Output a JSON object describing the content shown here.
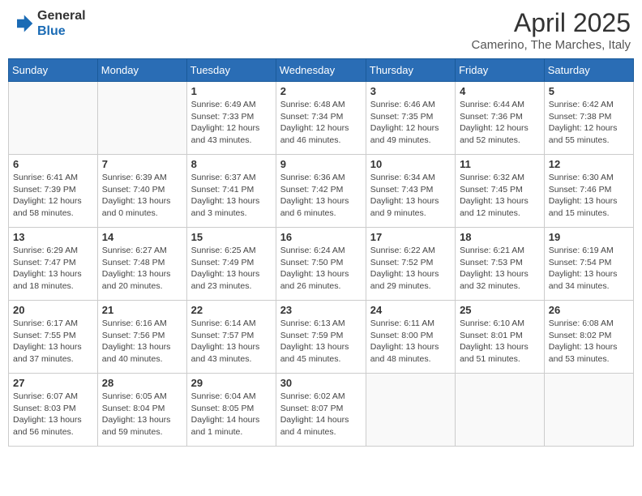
{
  "header": {
    "logo_general": "General",
    "logo_blue": "Blue",
    "main_title": "April 2025",
    "subtitle": "Camerino, The Marches, Italy"
  },
  "weekdays": [
    "Sunday",
    "Monday",
    "Tuesday",
    "Wednesday",
    "Thursday",
    "Friday",
    "Saturday"
  ],
  "weeks": [
    [
      {
        "day": "",
        "info": ""
      },
      {
        "day": "",
        "info": ""
      },
      {
        "day": "1",
        "info": "Sunrise: 6:49 AM\nSunset: 7:33 PM\nDaylight: 12 hours and 43 minutes."
      },
      {
        "day": "2",
        "info": "Sunrise: 6:48 AM\nSunset: 7:34 PM\nDaylight: 12 hours and 46 minutes."
      },
      {
        "day": "3",
        "info": "Sunrise: 6:46 AM\nSunset: 7:35 PM\nDaylight: 12 hours and 49 minutes."
      },
      {
        "day": "4",
        "info": "Sunrise: 6:44 AM\nSunset: 7:36 PM\nDaylight: 12 hours and 52 minutes."
      },
      {
        "day": "5",
        "info": "Sunrise: 6:42 AM\nSunset: 7:38 PM\nDaylight: 12 hours and 55 minutes."
      }
    ],
    [
      {
        "day": "6",
        "info": "Sunrise: 6:41 AM\nSunset: 7:39 PM\nDaylight: 12 hours and 58 minutes."
      },
      {
        "day": "7",
        "info": "Sunrise: 6:39 AM\nSunset: 7:40 PM\nDaylight: 13 hours and 0 minutes."
      },
      {
        "day": "8",
        "info": "Sunrise: 6:37 AM\nSunset: 7:41 PM\nDaylight: 13 hours and 3 minutes."
      },
      {
        "day": "9",
        "info": "Sunrise: 6:36 AM\nSunset: 7:42 PM\nDaylight: 13 hours and 6 minutes."
      },
      {
        "day": "10",
        "info": "Sunrise: 6:34 AM\nSunset: 7:43 PM\nDaylight: 13 hours and 9 minutes."
      },
      {
        "day": "11",
        "info": "Sunrise: 6:32 AM\nSunset: 7:45 PM\nDaylight: 13 hours and 12 minutes."
      },
      {
        "day": "12",
        "info": "Sunrise: 6:30 AM\nSunset: 7:46 PM\nDaylight: 13 hours and 15 minutes."
      }
    ],
    [
      {
        "day": "13",
        "info": "Sunrise: 6:29 AM\nSunset: 7:47 PM\nDaylight: 13 hours and 18 minutes."
      },
      {
        "day": "14",
        "info": "Sunrise: 6:27 AM\nSunset: 7:48 PM\nDaylight: 13 hours and 20 minutes."
      },
      {
        "day": "15",
        "info": "Sunrise: 6:25 AM\nSunset: 7:49 PM\nDaylight: 13 hours and 23 minutes."
      },
      {
        "day": "16",
        "info": "Sunrise: 6:24 AM\nSunset: 7:50 PM\nDaylight: 13 hours and 26 minutes."
      },
      {
        "day": "17",
        "info": "Sunrise: 6:22 AM\nSunset: 7:52 PM\nDaylight: 13 hours and 29 minutes."
      },
      {
        "day": "18",
        "info": "Sunrise: 6:21 AM\nSunset: 7:53 PM\nDaylight: 13 hours and 32 minutes."
      },
      {
        "day": "19",
        "info": "Sunrise: 6:19 AM\nSunset: 7:54 PM\nDaylight: 13 hours and 34 minutes."
      }
    ],
    [
      {
        "day": "20",
        "info": "Sunrise: 6:17 AM\nSunset: 7:55 PM\nDaylight: 13 hours and 37 minutes."
      },
      {
        "day": "21",
        "info": "Sunrise: 6:16 AM\nSunset: 7:56 PM\nDaylight: 13 hours and 40 minutes."
      },
      {
        "day": "22",
        "info": "Sunrise: 6:14 AM\nSunset: 7:57 PM\nDaylight: 13 hours and 43 minutes."
      },
      {
        "day": "23",
        "info": "Sunrise: 6:13 AM\nSunset: 7:59 PM\nDaylight: 13 hours and 45 minutes."
      },
      {
        "day": "24",
        "info": "Sunrise: 6:11 AM\nSunset: 8:00 PM\nDaylight: 13 hours and 48 minutes."
      },
      {
        "day": "25",
        "info": "Sunrise: 6:10 AM\nSunset: 8:01 PM\nDaylight: 13 hours and 51 minutes."
      },
      {
        "day": "26",
        "info": "Sunrise: 6:08 AM\nSunset: 8:02 PM\nDaylight: 13 hours and 53 minutes."
      }
    ],
    [
      {
        "day": "27",
        "info": "Sunrise: 6:07 AM\nSunset: 8:03 PM\nDaylight: 13 hours and 56 minutes."
      },
      {
        "day": "28",
        "info": "Sunrise: 6:05 AM\nSunset: 8:04 PM\nDaylight: 13 hours and 59 minutes."
      },
      {
        "day": "29",
        "info": "Sunrise: 6:04 AM\nSunset: 8:05 PM\nDaylight: 14 hours and 1 minute."
      },
      {
        "day": "30",
        "info": "Sunrise: 6:02 AM\nSunset: 8:07 PM\nDaylight: 14 hours and 4 minutes."
      },
      {
        "day": "",
        "info": ""
      },
      {
        "day": "",
        "info": ""
      },
      {
        "day": "",
        "info": ""
      }
    ]
  ]
}
